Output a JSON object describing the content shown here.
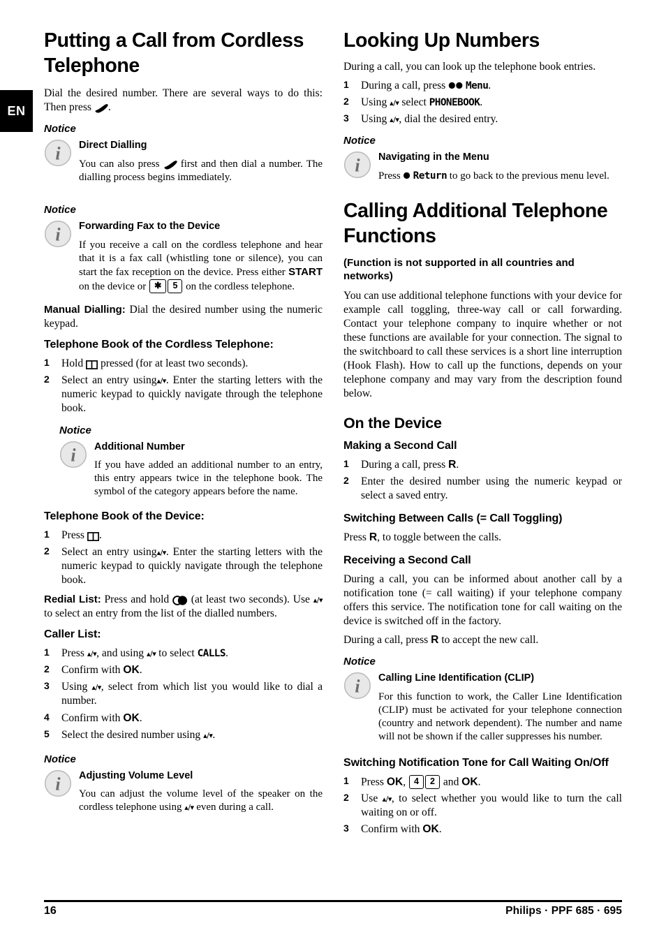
{
  "language_tab": "EN",
  "footer": {
    "page_number": "16",
    "brand": "Philips · PPF 685 · 695"
  },
  "icons": {
    "info": "info-circle-icon",
    "phone": "phone-handset-icon",
    "book": "telephone-book-icon",
    "redial": "redial-icon"
  },
  "left_column": {
    "heading": "Putting a Call from Cordless Telephone",
    "intro_before": "Dial the desired number. There are several ways to do this: Then press",
    "intro_after": ".",
    "notice_label": "Notice",
    "notice_direct_dialling": {
      "title": "Direct Dialling",
      "text_before": "You can also press",
      "text_after": "first and then dial a number. The dialling process begins immediately."
    },
    "notice_forwarding_fax": {
      "title": "Forwarding Fax to the Device",
      "text_part1": "If you receive a call on the cordless telephone and hear that it is a fax call (whistling tone or silence), you can start the fax reception on the device. Press either",
      "start_key": "START",
      "text_part2": "on the device or",
      "key_star": "✱",
      "key_5": "5",
      "text_part3": "on the cordless telephone."
    },
    "manual_dialling": {
      "label": "Manual Dialling:",
      "text": "Dial the desired number using the numeric keypad."
    },
    "cordless_book_heading": "Telephone Book of the Cordless Telephone:",
    "cordless_book_steps": [
      {
        "num": "1",
        "before": "Hold",
        "after": "pressed (for at least two seconds).",
        "icon": "book"
      },
      {
        "num": "2",
        "before": "Select an entry using",
        "nav": "▴/▾",
        "after": ". Enter the starting letters with the numeric keypad to quickly navigate through the telephone book."
      }
    ],
    "notice_additional_number": {
      "title": "Additional Number",
      "text": "If you have added an additional number to an entry, this entry appears twice in the telephone book. The symbol of the category appears before the name."
    },
    "device_book_heading": "Telephone Book of the Device:",
    "device_book_steps": [
      {
        "num": "1",
        "before": "Press",
        "after": ".",
        "icon": "book"
      },
      {
        "num": "2",
        "before": "Select an entry using",
        "nav": "▴/▾",
        "after": ". Enter the starting letters with the numeric keypad to quickly navigate through the telephone book."
      }
    ],
    "redial_list": {
      "label": "Redial List:",
      "text_before": "Press and hold",
      "text_mid": "(at least two seconds). Use",
      "nav": "▴/▾",
      "text_after": "to select an entry from the list of the dialled numbers."
    },
    "caller_list_heading": "Caller List:",
    "caller_list_steps": [
      {
        "num": "1",
        "before": "Press",
        "nav1": "▴/▾",
        "mid": ", and using",
        "nav2": "▴/▾",
        "mid2": "to select",
        "lcd": "CALLS",
        "after": "."
      },
      {
        "num": "2",
        "before": "Confirm with",
        "bold": "OK",
        "after": "."
      },
      {
        "num": "3",
        "before": "Using",
        "nav": "▴/▾",
        "after": ", select from which list you would like to dial a number."
      },
      {
        "num": "4",
        "before": "Confirm with",
        "bold": "OK",
        "after": "."
      },
      {
        "num": "5",
        "before": "Select the desired number using",
        "nav": "▴/▾",
        "after": "."
      }
    ],
    "notice_volume": {
      "title": "Adjusting Volume Level",
      "text_before": "You can adjust the volume level of the speaker on the cordless telephone using",
      "nav": "▴/▾",
      "text_after": "even during a call."
    }
  },
  "right_column": {
    "heading_looking_up": "Looking Up Numbers",
    "looking_up_intro": "During a call, you can look up the telephone book entries.",
    "looking_up_steps": [
      {
        "num": "1",
        "before": "During a call, press",
        "dots": "●●",
        "lcd": "Menu",
        "after": "."
      },
      {
        "num": "2",
        "before": "Using",
        "nav": "▴/▾",
        "mid": "select",
        "lcd": "PHONEBOOK",
        "after": "."
      },
      {
        "num": "3",
        "before": "Using",
        "nav": "▴/▾",
        "after": ", dial the desired entry."
      }
    ],
    "notice_label": "Notice",
    "notice_navigating": {
      "title": "Navigating in the Menu",
      "text_before": "Press",
      "dot": "●",
      "lcd": "Return",
      "text_after": "to go back to the previous menu level."
    },
    "heading_calling_additional": "Calling Additional Telephone Functions",
    "subheading_not_supported": "(Function is not supported in all countries and networks)",
    "additional_intro": "You can use additional telephone functions with your device for example call toggling, three-way call or call forwarding. Contact your telephone company to inquire whether or not these functions are available for your connection. The signal to the switchboard to call these services is a short line interruption (Hook Flash). How to call up the functions, depends on your telephone company and may vary from the description found below.",
    "heading_on_the_device": "On the Device",
    "heading_making_second_call": "Making a Second Call",
    "making_second_call_steps": [
      {
        "num": "1",
        "before": "During a call, press",
        "bold": "R",
        "after": "."
      },
      {
        "num": "2",
        "before": "Enter the desired number using the numeric keypad or select a saved entry.",
        "bold": "",
        "after": ""
      }
    ],
    "heading_switching_calls": "Switching Between Calls (= Call Toggling)",
    "switching_calls_text_before": "Press",
    "switching_calls_bold": "R",
    "switching_calls_text_after": ", to toggle between the calls.",
    "heading_receiving_second_call": "Receiving a Second Call",
    "receiving_p1": "During a call, you can be informed about another call by a notification tone (= call waiting) if your telephone company offers this service. The notification tone for call waiting on the device is switched off in the factory.",
    "receiving_p2_before": "During a call, press",
    "receiving_p2_bold": "R",
    "receiving_p2_after": "to accept the new call.",
    "notice_clip": {
      "title": "Calling Line Identification (CLIP)",
      "text": "For this function to work, the Caller Line Identification (CLIP) must be activated for your telephone connection (country and network dependent). The number and name will not be shown if the caller suppresses his number."
    },
    "heading_switching_notification": "Switching Notification Tone for Call Waiting On/Off",
    "switching_notification_steps": [
      {
        "num": "1",
        "before": "Press",
        "bold1": "OK",
        "comma": ",",
        "key1": "4",
        "key2": "2",
        "mid": "and",
        "bold2": "OK",
        "after": "."
      },
      {
        "num": "2",
        "before": "Use",
        "nav": "▴/▾",
        "after": ", to select whether you would like to turn the call waiting on or off."
      },
      {
        "num": "3",
        "before": "Confirm with",
        "bold1": "OK",
        "after": "."
      }
    ]
  }
}
